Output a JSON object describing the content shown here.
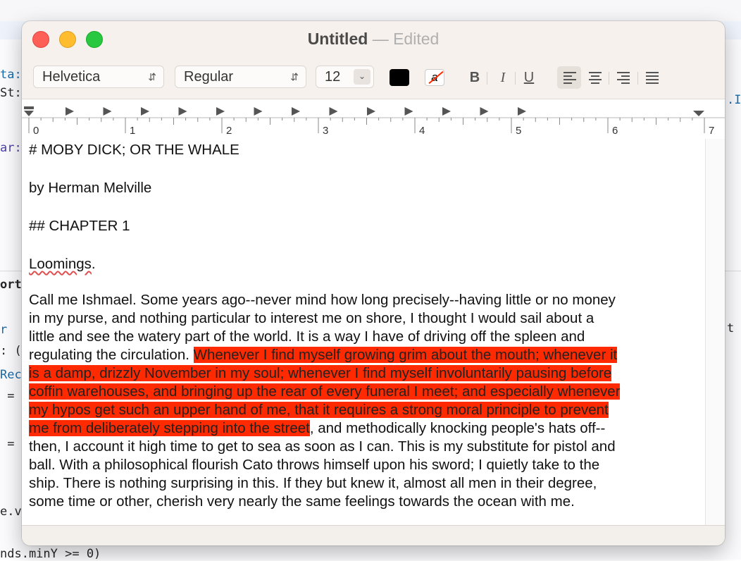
{
  "background_editor": {
    "code_fragments": [
      "ta:",
      "St:",
      "ar:",
      "ort",
      "r ",
      ": (",
      "Rec",
      " =",
      " =",
      "e.v",
      ".I",
      "t .",
      "nds.minY >= 0)"
    ]
  },
  "window": {
    "title": "Untitled",
    "title_separator": "—",
    "title_status": "Edited"
  },
  "toolbar": {
    "font_family": "Helvetica",
    "font_style": "Regular",
    "font_size": "12",
    "bold_label": "B",
    "italic_label": "I",
    "underline_label": "U",
    "bg_color_glyph": "a",
    "text_color": "#000000",
    "highlight_color": "#ff2a00",
    "alignment_selected": "left"
  },
  "ruler": {
    "numbers": [
      "0",
      "1",
      "2",
      "3",
      "4",
      "5",
      "6",
      "7"
    ]
  },
  "document": {
    "heading": "# MOBY DICK; OR THE WHALE",
    "author": "by Herman Melville",
    "chapter": "## CHAPTER 1",
    "chapter_title": "Loomings",
    "chapter_title_period": ".",
    "para_lines": [
      "Call me Ishmael.  Some years ago--never mind how long precisely--having little or no money",
      "in my purse, and nothing particular to interest me on shore, I thought I would sail about a",
      "little and see the watery part of the world.  It is a way I have of driving off the spleen and"
    ],
    "line4_plain": "regulating the circulation.  ",
    "line4_hl": "Whenever I find myself growing grim about the mouth; whenever it",
    "hl_lines": [
      "is a damp, drizzly November in my soul; whenever I find myself involuntarily pausing before",
      "coffin warehouses, and bringing up the rear of every funeral I meet; and especially whenever",
      "my hypos get such an upper hand of me, that it requires a strong moral principle to prevent"
    ],
    "line8_hl": "me from deliberately stepping into the street",
    "line8_plain": ", and methodically knocking people's hats off--",
    "tail_lines": [
      "then, I account it high time to get to sea as soon as I can.  This is my substitute for pistol and",
      "ball.  With a philosophical flourish Cato throws himself upon his sword; I quietly take to the",
      "ship.  There is nothing surprising in this.  If they but knew it, almost all men in their degree,",
      "some time or other, cherish very nearly the same feelings towards the ocean with me."
    ]
  }
}
